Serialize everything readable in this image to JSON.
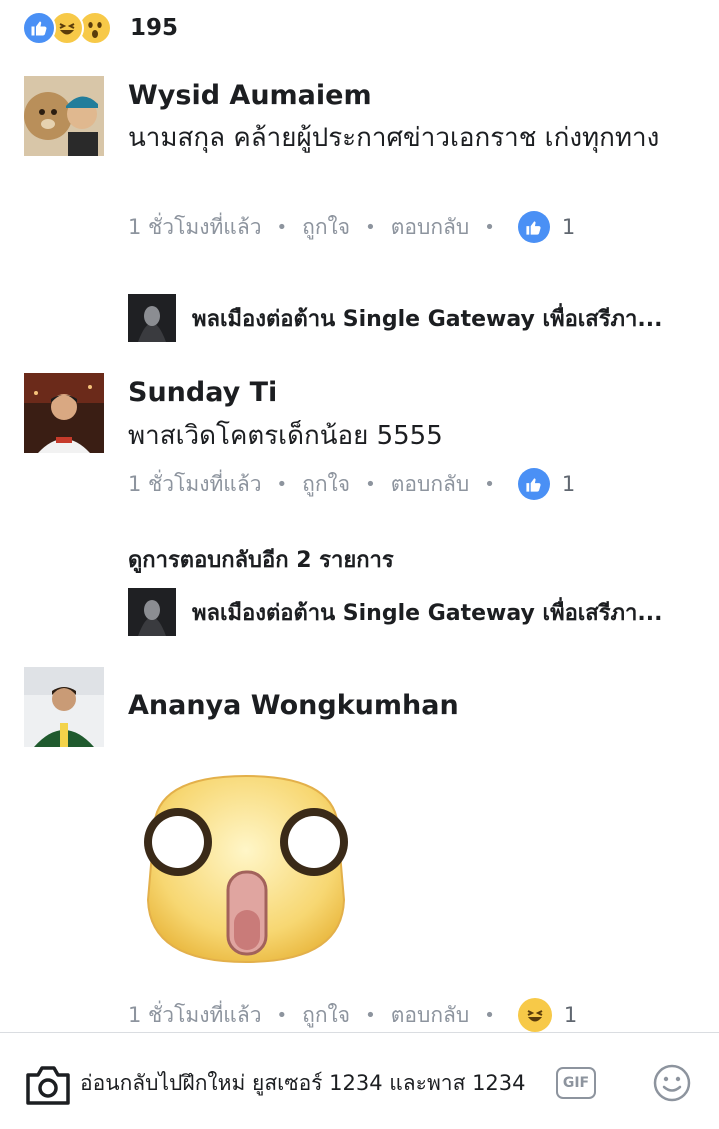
{
  "reactions": {
    "icons": [
      "like-icon",
      "haha-icon",
      "wow-icon"
    ],
    "count": "195"
  },
  "comments": [
    {
      "author": "Wysid Aumaiem",
      "text": "นามสกุล คล้ายผู้ประกาศข่าวเอกราช เก่งทุกทาง",
      "time": "1 ชั่วโมงที่แล้ว",
      "like": "ถูกใจ",
      "reply": "ตอบกลับ",
      "reaction_icon": "like-icon",
      "reaction_count": "1",
      "reply_preview": "พลเมืองต่อต้าน Single Gateway เพื่อเสรีภา..."
    },
    {
      "author": "Sunday Ti",
      "text": "พาสเวิดโคตรเด็กน้อย 5555",
      "time": "1 ชั่วโมงที่แล้ว",
      "like": "ถูกใจ",
      "reply": "ตอบกลับ",
      "reaction_icon": "like-icon",
      "reaction_count": "1",
      "more_replies": "ดูการตอบกลับอีก 2 รายการ",
      "reply_preview": "พลเมืองต่อต้าน Single Gateway เพื่อเสรีภา..."
    },
    {
      "author": "Ananya Wongkumhan",
      "sticker": "shocked-face-sticker",
      "time": "1 ชั่วโมงที่แล้ว",
      "like": "ถูกใจ",
      "reply": "ตอบกลับ",
      "reaction_icon": "haha-icon",
      "reaction_count": "1"
    }
  ],
  "composer": {
    "text": "อ่อนกลับไปฝึกใหม่ ยูสเซอร์ 1234 และพาส 1234",
    "gif_label": "GIF",
    "camera_icon": "camera-icon",
    "emoji_icon": "smiley-icon"
  },
  "colors": {
    "like_blue": "#4a90f5",
    "reaction_yellow": "#f7c948",
    "meta_gray": "#8d949e"
  }
}
